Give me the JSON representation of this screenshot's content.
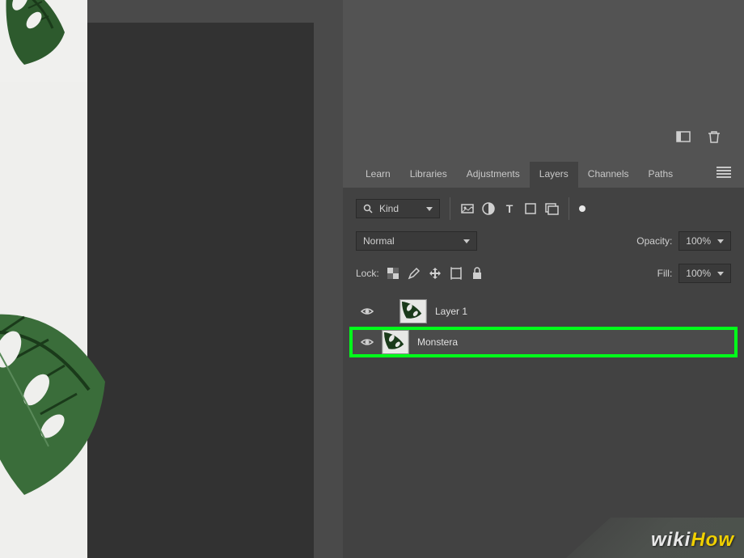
{
  "tabs": {
    "learn": "Learn",
    "libraries": "Libraries",
    "adjustments": "Adjustments",
    "layers": "Layers",
    "channels": "Channels",
    "paths": "Paths"
  },
  "filter": {
    "kind_label": "Kind"
  },
  "blend": {
    "mode": "Normal",
    "opacity_label": "Opacity:",
    "opacity_value": "100%"
  },
  "lock": {
    "label": "Lock:",
    "fill_label": "Fill:",
    "fill_value": "100%"
  },
  "layers": [
    {
      "name": "Layer 1"
    },
    {
      "name": "Monstera"
    }
  ],
  "watermark": {
    "wiki": "wiki",
    "how": "How"
  }
}
